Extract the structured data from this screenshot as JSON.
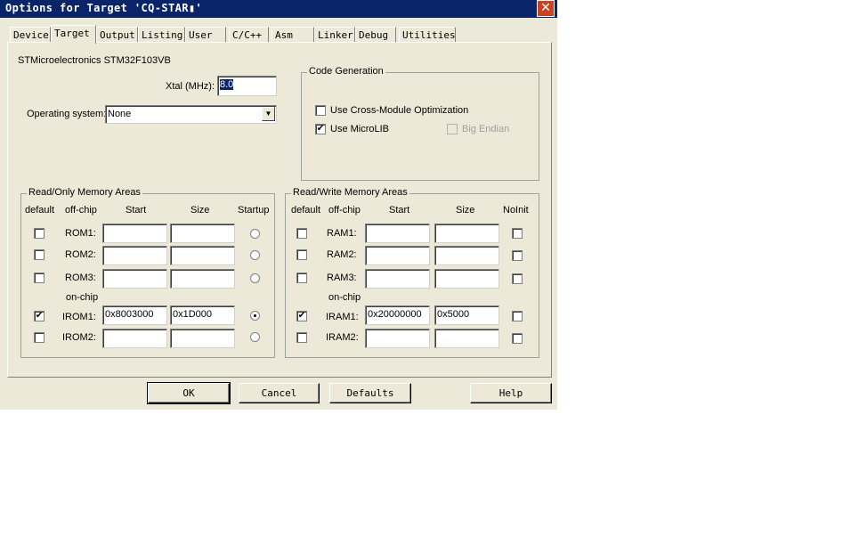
{
  "window": {
    "title": "Options for Target 'CQ-STAR▮'",
    "close_label": "✕"
  },
  "tabs": [
    "Device",
    "Target",
    "Output",
    "Listing",
    "User",
    "C/C++",
    "Asm",
    "Linker",
    "Debug",
    "Utilities"
  ],
  "active_tab": "Target",
  "device_name": "STMicroelectronics STM32F103VB",
  "xtal": {
    "label": "Xtal (MHz):",
    "value": "8.0"
  },
  "os": {
    "label": "Operating system:",
    "value": "None"
  },
  "code_gen": {
    "title": "Code Generation",
    "cross_module": {
      "label": "Use Cross-Module Optimization",
      "checked": false
    },
    "microlib": {
      "label": "Use MicroLIB",
      "checked": true
    },
    "big_endian": {
      "label": "Big Endian",
      "checked": false,
      "enabled": false
    }
  },
  "rom": {
    "title": "Read/Only Memory Areas",
    "headers": {
      "default": "default",
      "offchip": "off-chip",
      "start": "Start",
      "size": "Size",
      "extra": "Startup"
    },
    "onchip_label": "on-chip",
    "rows": [
      {
        "label": "ROM1:",
        "default": false,
        "start": "",
        "size": "",
        "startup": false
      },
      {
        "label": "ROM2:",
        "default": false,
        "start": "",
        "size": "",
        "startup": false
      },
      {
        "label": "ROM3:",
        "default": false,
        "start": "",
        "size": "",
        "startup": false
      },
      {
        "label": "IROM1:",
        "default": true,
        "start": "0x8003000",
        "size": "0x1D000",
        "startup": true
      },
      {
        "label": "IROM2:",
        "default": false,
        "start": "",
        "size": "",
        "startup": false
      }
    ]
  },
  "ram": {
    "title": "Read/Write Memory Areas",
    "headers": {
      "default": "default",
      "offchip": "off-chip",
      "start": "Start",
      "size": "Size",
      "extra": "NoInit"
    },
    "onchip_label": "on-chip",
    "rows": [
      {
        "label": "RAM1:",
        "default": false,
        "start": "",
        "size": "",
        "noinit": false
      },
      {
        "label": "RAM2:",
        "default": false,
        "start": "",
        "size": "",
        "noinit": false
      },
      {
        "label": "RAM3:",
        "default": false,
        "start": "",
        "size": "",
        "noinit": false
      },
      {
        "label": "IRAM1:",
        "default": true,
        "start": "0x20000000",
        "size": "0x5000",
        "noinit": false
      },
      {
        "label": "IRAM2:",
        "default": false,
        "start": "",
        "size": "",
        "noinit": false
      }
    ]
  },
  "buttons": {
    "ok": "OK",
    "cancel": "Cancel",
    "defaults": "Defaults",
    "help": "Help"
  },
  "check_glyph": "✔",
  "dropdown_glyph": "▼"
}
